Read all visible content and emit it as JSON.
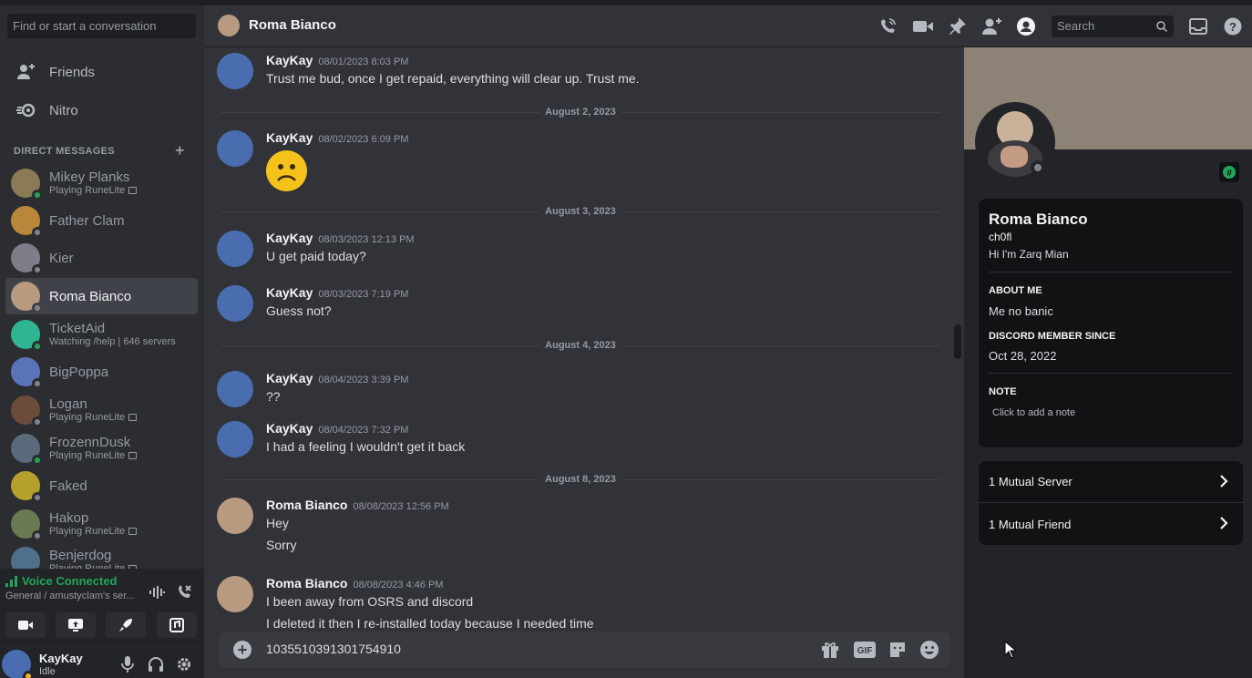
{
  "sidebar": {
    "search_placeholder": "Find or start a conversation",
    "nav": [
      {
        "label": "Friends",
        "icon": "friends-icon"
      },
      {
        "label": "Nitro",
        "icon": "nitro-icon"
      }
    ],
    "dm_header": "DIRECT MESSAGES",
    "dms": [
      {
        "name": "Mikey Planks",
        "sub": "Playing RuneLite",
        "status": "online",
        "color": "#8a7a55"
      },
      {
        "name": "Father Clam",
        "sub": "",
        "status": "offline",
        "color": "#b8873a"
      },
      {
        "name": "Kier",
        "sub": "",
        "status": "offline",
        "color": "#7c7d86"
      },
      {
        "name": "Roma Bianco",
        "sub": "",
        "status": "offline",
        "color": "#b89a80",
        "active": true
      },
      {
        "name": "TicketAid",
        "sub": "Watching /help | 646 servers",
        "status": "online",
        "color": "#2fb592"
      },
      {
        "name": "BigPoppa",
        "sub": "",
        "status": "offline",
        "color": "#5b74b8"
      },
      {
        "name": "Logan",
        "sub": "Playing RuneLite",
        "status": "offline",
        "color": "#6b4c3a"
      },
      {
        "name": "FrozennDusk",
        "sub": "Playing RuneLite",
        "status": "online",
        "color": "#5a6a7a"
      },
      {
        "name": "Faked",
        "sub": "",
        "status": "offline",
        "color": "#b59f2d"
      },
      {
        "name": "Hakop",
        "sub": "Playing RuneLite",
        "status": "offline",
        "color": "#6a7a52"
      },
      {
        "name": "Benjerdog",
        "sub": "Playing RuneLite",
        "status": "offline",
        "color": "#4f6f8a"
      }
    ],
    "voice": {
      "title": "Voice Connected",
      "sub": "General / amustyclam's ser..."
    },
    "user": {
      "name": "KayKay",
      "status": "Idle"
    }
  },
  "header": {
    "title": "Roma Bianco",
    "search_placeholder": "Search"
  },
  "messages": [
    {
      "type": "msg",
      "author": "KayKay",
      "time": "08/01/2023 8:03 PM",
      "lines": [
        "Trust me bud, once I get repaid, everything will clear up. Trust me."
      ]
    },
    {
      "type": "divider",
      "label": "August 2, 2023"
    },
    {
      "type": "msg",
      "author": "KayKay",
      "time": "08/02/2023 6:09 PM",
      "emoji": "frowning-face"
    },
    {
      "type": "divider",
      "label": "August 3, 2023"
    },
    {
      "type": "msg",
      "author": "KayKay",
      "time": "08/03/2023 12:13 PM",
      "lines": [
        "U get paid today?"
      ]
    },
    {
      "type": "msg",
      "author": "KayKay",
      "time": "08/03/2023 7:19 PM",
      "lines": [
        "Guess not?"
      ]
    },
    {
      "type": "divider",
      "label": "August 4, 2023"
    },
    {
      "type": "msg",
      "author": "KayKay",
      "time": "08/04/2023 3:39 PM",
      "lines": [
        "??"
      ]
    },
    {
      "type": "msg",
      "author": "KayKay",
      "time": "08/04/2023 7:32 PM",
      "lines": [
        "I had a feeling I wouldn't get it back"
      ]
    },
    {
      "type": "divider",
      "label": "August 8, 2023"
    },
    {
      "type": "msg",
      "author": "Roma Bianco",
      "time": "08/08/2023 12:56 PM",
      "lines": [
        "Hey",
        "Sorry"
      ]
    },
    {
      "type": "msg",
      "author": "Roma Bianco",
      "time": "08/08/2023 4:46 PM",
      "lines": [
        "I been away from OSRS and discord",
        "I deleted it then I re-installed today because I needed time"
      ]
    }
  ],
  "composer": {
    "text": "1035510391301754910"
  },
  "profile": {
    "name": "Roma Bianco",
    "username": "ch0fl",
    "pronouns": "Hi I'm Zarq Mian",
    "about_label": "ABOUT ME",
    "about": "Me no banic",
    "member_label": "DISCORD MEMBER SINCE",
    "member_since": "Oct 28, 2022",
    "note_label": "NOTE",
    "note_placeholder": "Click to add a note",
    "mutual_servers": "1 Mutual Server",
    "mutual_friends": "1 Mutual Friend"
  },
  "colors": {
    "bg": "#313338",
    "sidebar": "#2b2d31",
    "online": "#23a55a",
    "accent": "#5865f2"
  }
}
